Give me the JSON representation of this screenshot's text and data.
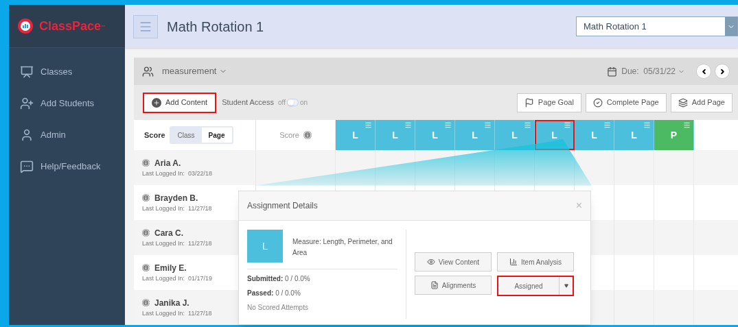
{
  "brand": {
    "name": "ClassPace",
    "mark": "™"
  },
  "sidebar": {
    "items": [
      {
        "label": "Classes"
      },
      {
        "label": "Add Students"
      },
      {
        "label": "Admin"
      },
      {
        "label": "Help/Feedback"
      }
    ]
  },
  "header": {
    "title": "Math Rotation 1",
    "class_select": {
      "value": "Math Rotation 1"
    }
  },
  "page_bar": {
    "group": "measurement",
    "due": "Due:  05/31/22"
  },
  "toolbar": {
    "add_content": {
      "label": "Add Content",
      "highlighted": true
    },
    "student_access": {
      "label": "Student Access",
      "off_label": "off",
      "on_label": "on",
      "on": false
    },
    "buttons": [
      {
        "label": "Page Goal"
      },
      {
        "label": "Complete Page"
      },
      {
        "label": "Add Page"
      }
    ]
  },
  "grid": {
    "score_label": "Score",
    "score_toggle": [
      {
        "label": "Class",
        "selected": false
      },
      {
        "label": "Page",
        "selected": true
      }
    ],
    "score_column": "Score",
    "columns": [
      {
        "letter": "L",
        "color": "#4bbfdc",
        "highlighted": false
      },
      {
        "letter": "L",
        "color": "#4bbfdc",
        "highlighted": false
      },
      {
        "letter": "L",
        "color": "#4bbfdc",
        "highlighted": false
      },
      {
        "letter": "L",
        "color": "#4bbfdc",
        "highlighted": false
      },
      {
        "letter": "L",
        "color": "#4bbfdc",
        "highlighted": false
      },
      {
        "letter": "L",
        "color": "#4bbfdc",
        "highlighted": true
      },
      {
        "letter": "L",
        "color": "#4bbfdc",
        "highlighted": false
      },
      {
        "letter": "L",
        "color": "#4bbfdc",
        "highlighted": false
      },
      {
        "letter": "P",
        "color": "#4cb963",
        "highlighted": false
      }
    ],
    "students": [
      {
        "name": "Aria A.",
        "last_login": "Last Logged In:  03/22/18"
      },
      {
        "name": "Brayden B.",
        "last_login": "Last Logged In:  11/27/18"
      },
      {
        "name": "Cara C.",
        "last_login": "Last Logged In:  11/27/18"
      },
      {
        "name": "Emily E.",
        "last_login": "Last Logged In:  01/17/19"
      },
      {
        "name": "Janika J.",
        "last_login": "Last Logged In:  11/27/18"
      }
    ]
  },
  "dialog": {
    "title": "Assignment Details",
    "close": "×",
    "tile": {
      "letter": "L",
      "color": "#4bbfdc"
    },
    "content_title": "Measure: Length, Perimeter, and Area",
    "stats": [
      {
        "label": "Submitted:",
        "value": " 0 / 0.0%"
      },
      {
        "label": "Passed:",
        "value": " 0 / 0.0%"
      }
    ],
    "note": "No Scored Attempts",
    "actions": [
      {
        "label": "View Content"
      },
      {
        "label": "Item Analysis"
      },
      {
        "label": "Alignments"
      }
    ],
    "status": {
      "label": "Assigned",
      "highlighted": true
    }
  }
}
